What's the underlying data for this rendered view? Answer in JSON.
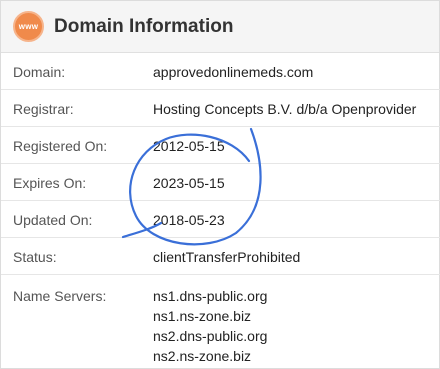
{
  "header": {
    "icon": "www-globe-icon",
    "icon_text": "www",
    "title": "Domain Information"
  },
  "rows": [
    {
      "label": "Domain:",
      "value": "approvedonlinemeds.com"
    },
    {
      "label": "Registrar:",
      "value": "Hosting Concepts B.V. d/b/a Openprovider"
    },
    {
      "label": "Registered On:",
      "value": "2012-05-15"
    },
    {
      "label": "Expires On:",
      "value": "2023-05-15"
    },
    {
      "label": "Updated On:",
      "value": "2018-05-23"
    },
    {
      "label": "Status:",
      "value": "clientTransferProhibited"
    }
  ],
  "name_servers": {
    "label": "Name Servers:",
    "values": [
      "ns1.dns-public.org",
      "ns1.ns-zone.biz",
      "ns2.dns-public.org",
      "ns2.ns-zone.biz"
    ]
  },
  "colors": {
    "accent": "#f08a4b",
    "annotation": "#3a6fd8"
  }
}
